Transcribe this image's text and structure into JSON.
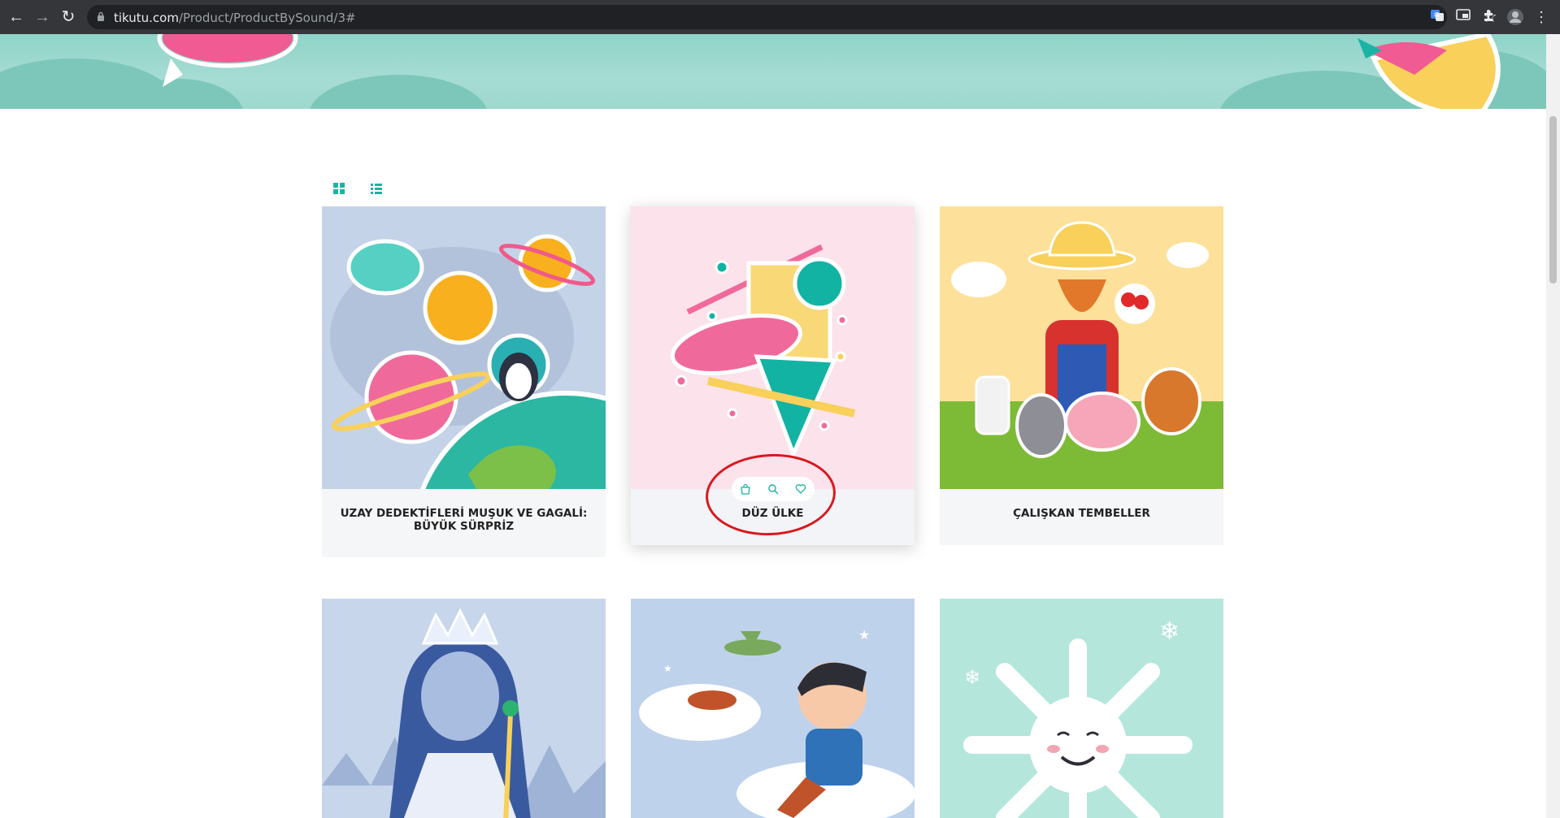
{
  "browser": {
    "url_host": "tikutu.com",
    "url_path": "/Product/ProductBySound/3#",
    "nav": {
      "back": "←",
      "forward": "→",
      "reload": "↻"
    },
    "icons": [
      "back-icon",
      "forward-icon",
      "reload-icon",
      "lock-icon",
      "bookmark-star-icon",
      "translate-icon",
      "cast-icon",
      "extensions-icon",
      "profile-avatar",
      "menu-dots-icon"
    ]
  },
  "colors": {
    "accent": "#1bb3a5",
    "banner": "#a6dcd3",
    "annotation": "#d8191f"
  },
  "view_toggles": {
    "grid_icon": "grid-view-icon",
    "list_icon": "list-view-icon"
  },
  "products": [
    {
      "title": "UZAY DEDEKTİFLERİ MUŞUK VE GAGALİ: BÜYÜK SÜRPRİZ",
      "image": "space-planets-penguin-illustration"
    },
    {
      "title": "DÜZ ÜLKE",
      "image": "geometric-shapes-illustration",
      "actions": [
        "shopping-bag-icon",
        "search-icon",
        "heart-icon"
      ]
    },
    {
      "title": "ÇALIŞKAN TEMBELLER",
      "image": "farmer-animals-illustration"
    },
    {
      "title": "",
      "image": "ice-queen-illustration"
    },
    {
      "title": "",
      "image": "boy-cloud-airplane-illustration"
    },
    {
      "title": "",
      "image": "snowflake-face-illustration"
    }
  ]
}
